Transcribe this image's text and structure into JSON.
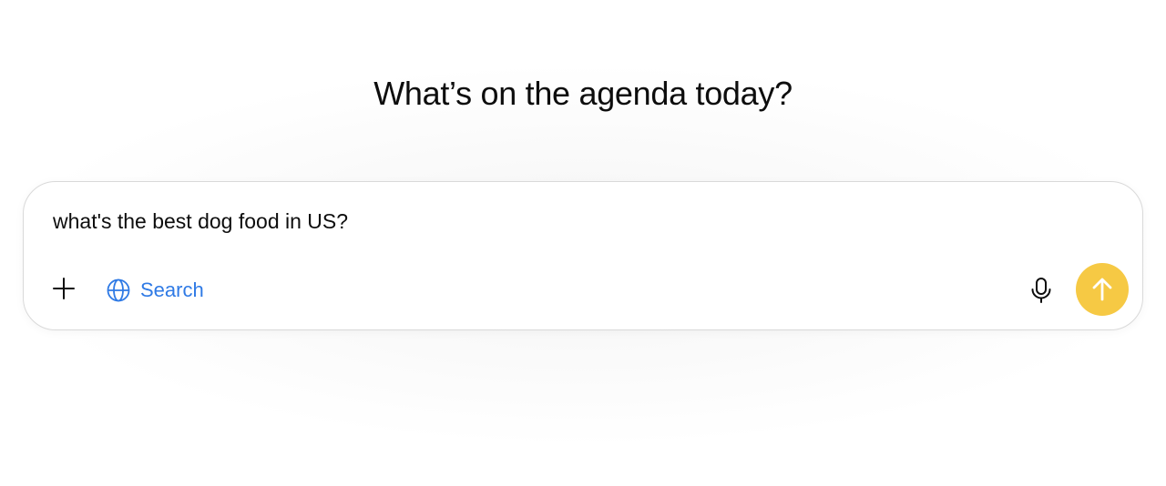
{
  "headline": "What’s on the agenda today?",
  "composer": {
    "input_value": "what's the best dog food in US?",
    "attach_icon": "plus-icon",
    "search": {
      "label": "Search",
      "icon": "globe-icon",
      "color": "#2f7ae5"
    },
    "voice_icon": "microphone-icon",
    "send": {
      "icon": "arrow-up-icon",
      "color": "#f6c944"
    }
  }
}
